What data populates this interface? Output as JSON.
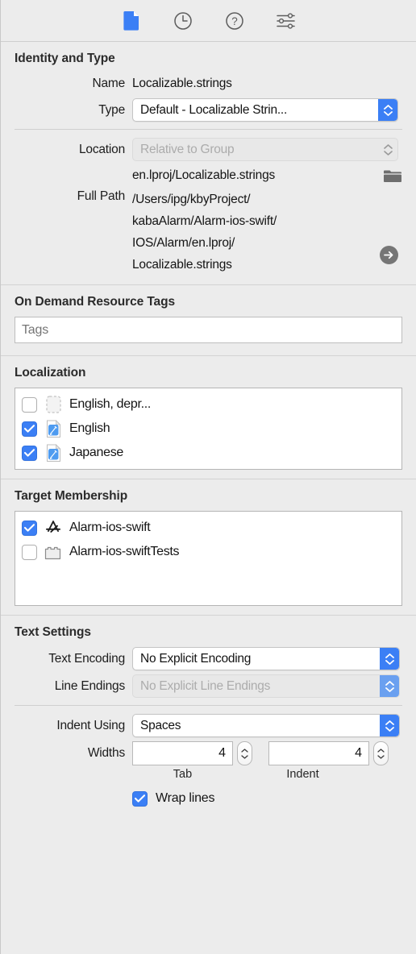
{
  "toolbar": {
    "items": [
      {
        "icon": "file-document-icon",
        "name": "file-inspector-tab",
        "selected": true
      },
      {
        "icon": "clock-history-icon",
        "name": "history-inspector-tab",
        "selected": false
      },
      {
        "icon": "question-mark-help-icon",
        "name": "quick-help-inspector-tab",
        "selected": false
      },
      {
        "icon": "sliders-settings-icon",
        "name": "custom-settings-tab",
        "selected": false
      }
    ],
    "accent_color": "#3b7ff5"
  },
  "identity": {
    "title": "Identity and Type",
    "name_label": "Name",
    "name_value": "Localizable.strings",
    "type_label": "Type",
    "type_value": "Default - Localizable Strin...",
    "location_label": "Location",
    "location_value": "Relative to Group",
    "location_path": "en.lproj/Localizable.strings",
    "fullpath_label": "Full Path",
    "fullpath_lines": [
      "/Users/ipg/kbyProject/",
      "kabaAlarm/Alarm-ios-swift/",
      "IOS/Alarm/en.lproj/",
      "Localizable.strings"
    ]
  },
  "ondemand": {
    "title": "On Demand Resource Tags",
    "tags_value": "",
    "tags_placeholder": "Tags"
  },
  "localization": {
    "title": "Localization",
    "rows": [
      {
        "label": "English, depr...",
        "checked": false,
        "icon": "placeholder-file-icon"
      },
      {
        "label": "English",
        "checked": true,
        "icon": "strings-file-icon"
      },
      {
        "label": "Japanese",
        "checked": true,
        "icon": "strings-file-icon"
      }
    ]
  },
  "target_membership": {
    "title": "Target Membership",
    "rows": [
      {
        "label": "Alarm-ios-swift",
        "checked": true,
        "icon": "app-target-icon"
      },
      {
        "label": "Alarm-ios-swiftTests",
        "checked": false,
        "icon": "test-bundle-icon"
      }
    ]
  },
  "text_settings": {
    "title": "Text Settings",
    "encoding_label": "Text Encoding",
    "encoding_value": "No Explicit Encoding",
    "line_endings_label": "Line Endings",
    "line_endings_value": "No Explicit Line Endings",
    "indent_label": "Indent Using",
    "indent_value": "Spaces",
    "widths_label": "Widths",
    "tab_width": "4",
    "tab_caption": "Tab",
    "indent_width": "4",
    "indent_caption": "Indent",
    "wrap_label": "Wrap lines",
    "wrap_checked": true
  }
}
